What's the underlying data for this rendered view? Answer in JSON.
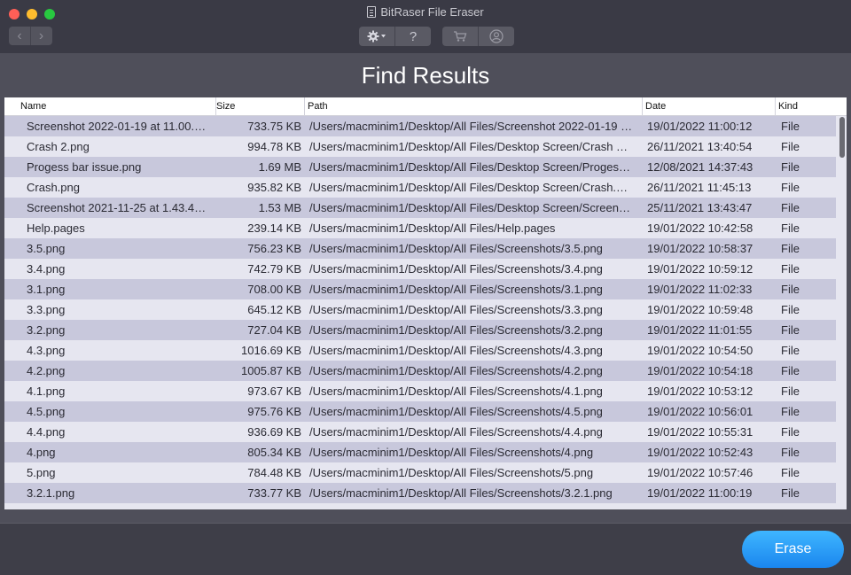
{
  "window": {
    "title": "BitRaser File Eraser"
  },
  "toolbar": {
    "back_icon": "‹",
    "forward_icon": "›",
    "settings_icon": "gear-icon",
    "help_label": "?",
    "cart_icon": "cart-icon",
    "account_icon": "user-icon"
  },
  "page": {
    "title": "Find Results"
  },
  "table": {
    "headers": {
      "name": "Name",
      "size": "Size",
      "path": "Path",
      "date": "Date",
      "kind": "Kind"
    },
    "rows": [
      {
        "name": "Screenshot 2022-01-19 at 11.00.…",
        "size": "733.75 KB",
        "path": "/Users/macminim1/Desktop/All Files/Screenshot 2022-01-19 …",
        "date": "19/01/2022 11:00:12",
        "kind": "File"
      },
      {
        "name": "Crash 2.png",
        "size": "994.78 KB",
        "path": "/Users/macminim1/Desktop/All Files/Desktop Screen/Crash …",
        "date": "26/11/2021 13:40:54",
        "kind": "File"
      },
      {
        "name": "Progess bar issue.png",
        "size": "1.69 MB",
        "path": "/Users/macminim1/Desktop/All Files/Desktop Screen/Proges…",
        "date": "12/08/2021 14:37:43",
        "kind": "File"
      },
      {
        "name": "Crash.png",
        "size": "935.82 KB",
        "path": "/Users/macminim1/Desktop/All Files/Desktop Screen/Crash.…",
        "date": "26/11/2021 11:45:13",
        "kind": "File"
      },
      {
        "name": "Screenshot 2021-11-25 at 1.43.4…",
        "size": "1.53 MB",
        "path": "/Users/macminim1/Desktop/All Files/Desktop Screen/Screen…",
        "date": "25/11/2021 13:43:47",
        "kind": "File"
      },
      {
        "name": "Help.pages",
        "size": "239.14 KB",
        "path": "/Users/macminim1/Desktop/All Files/Help.pages",
        "date": "19/01/2022 10:42:58",
        "kind": "File"
      },
      {
        "name": "3.5.png",
        "size": "756.23 KB",
        "path": "/Users/macminim1/Desktop/All Files/Screenshots/3.5.png",
        "date": "19/01/2022 10:58:37",
        "kind": "File"
      },
      {
        "name": "3.4.png",
        "size": "742.79 KB",
        "path": "/Users/macminim1/Desktop/All Files/Screenshots/3.4.png",
        "date": "19/01/2022 10:59:12",
        "kind": "File"
      },
      {
        "name": "3.1.png",
        "size": "708.00 KB",
        "path": "/Users/macminim1/Desktop/All Files/Screenshots/3.1.png",
        "date": "19/01/2022 11:02:33",
        "kind": "File"
      },
      {
        "name": "3.3.png",
        "size": "645.12 KB",
        "path": "/Users/macminim1/Desktop/All Files/Screenshots/3.3.png",
        "date": "19/01/2022 10:59:48",
        "kind": "File"
      },
      {
        "name": "3.2.png",
        "size": "727.04 KB",
        "path": "/Users/macminim1/Desktop/All Files/Screenshots/3.2.png",
        "date": "19/01/2022 11:01:55",
        "kind": "File"
      },
      {
        "name": "4.3.png",
        "size": "1016.69 KB",
        "path": "/Users/macminim1/Desktop/All Files/Screenshots/4.3.png",
        "date": "19/01/2022 10:54:50",
        "kind": "File"
      },
      {
        "name": "4.2.png",
        "size": "1005.87 KB",
        "path": "/Users/macminim1/Desktop/All Files/Screenshots/4.2.png",
        "date": "19/01/2022 10:54:18",
        "kind": "File"
      },
      {
        "name": "4.1.png",
        "size": "973.67 KB",
        "path": "/Users/macminim1/Desktop/All Files/Screenshots/4.1.png",
        "date": "19/01/2022 10:53:12",
        "kind": "File"
      },
      {
        "name": "4.5.png",
        "size": "975.76 KB",
        "path": "/Users/macminim1/Desktop/All Files/Screenshots/4.5.png",
        "date": "19/01/2022 10:56:01",
        "kind": "File"
      },
      {
        "name": "4.4.png",
        "size": "936.69 KB",
        "path": "/Users/macminim1/Desktop/All Files/Screenshots/4.4.png",
        "date": "19/01/2022 10:55:31",
        "kind": "File"
      },
      {
        "name": "4.png",
        "size": "805.34 KB",
        "path": "/Users/macminim1/Desktop/All Files/Screenshots/4.png",
        "date": "19/01/2022 10:52:43",
        "kind": "File"
      },
      {
        "name": "5.png",
        "size": "784.48 KB",
        "path": "/Users/macminim1/Desktop/All Files/Screenshots/5.png",
        "date": "19/01/2022 10:57:46",
        "kind": "File"
      },
      {
        "name": "3.2.1.png",
        "size": "733.77 KB",
        "path": "/Users/macminim1/Desktop/All Files/Screenshots/3.2.1.png",
        "date": "19/01/2022 11:00:19",
        "kind": "File"
      }
    ]
  },
  "footer": {
    "erase_label": "Erase"
  },
  "colors": {
    "accent": "#1a86ee",
    "row_alt": "#c8c8dc",
    "row": "#e6e6f0",
    "background": "#4f4f5a"
  }
}
